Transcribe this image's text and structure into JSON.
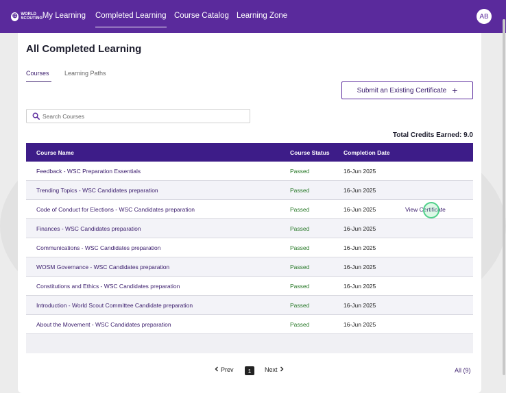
{
  "nav": {
    "logo_mark": "⊕",
    "logo_text_line1": "WORLD",
    "logo_text_line2": "SCOUTING",
    "items": [
      "My Learning",
      "Completed Learning",
      "Course Catalog",
      "Learning Zone"
    ],
    "avatar_initials": "AB"
  },
  "page": {
    "title": "All Completed Learning",
    "tabs": [
      "Courses",
      "Learning Paths"
    ],
    "submit_button": "Submit an Existing Certificate",
    "submit_icon": "+",
    "search_placeholder": "Search Courses",
    "credits_label": "Total Credits Earned: 9.0"
  },
  "table": {
    "headers": [
      "Course Name",
      "Course Status",
      "Completion Date",
      ""
    ],
    "rows": [
      {
        "name": "Feedback - WSC Preparation Essentials",
        "status": "Passed",
        "date": "16-Jun 2025",
        "action": ""
      },
      {
        "name": "Trending Topics - WSC Candidates preparation",
        "status": "Passed",
        "date": "16-Jun 2025",
        "action": ""
      },
      {
        "name": "Code of Conduct for Elections - WSC Candidates preparation",
        "status": "Passed",
        "date": "16-Jun 2025",
        "action": "View Certificate"
      },
      {
        "name": "Finances - WSC Candidates preparation",
        "status": "Passed",
        "date": "16-Jun 2025",
        "action": ""
      },
      {
        "name": "Communications - WSC Candidates preparation",
        "status": "Passed",
        "date": "16-Jun 2025",
        "action": ""
      },
      {
        "name": "WOSM Governance - WSC Candidates preparation",
        "status": "Passed",
        "date": "16-Jun 2025",
        "action": ""
      },
      {
        "name": "Constitutions and Ethics - WSC Candidates preparation",
        "status": "Passed",
        "date": "16-Jun 2025",
        "action": ""
      },
      {
        "name": "Introduction - World Scout Committee Candidate preparation",
        "status": "Passed",
        "date": "16-Jun 2025",
        "action": ""
      },
      {
        "name": "About the Movement - WSC Candidates preparation",
        "status": "Passed",
        "date": "16-Jun 2025",
        "action": ""
      }
    ]
  },
  "pager": {
    "prev": "Prev",
    "page": "1",
    "next": "Next",
    "all": "All (9)"
  },
  "colors": {
    "brand": "#5a2a9c",
    "table_header": "#3d1c88",
    "passed": "#2a7a2a"
  }
}
